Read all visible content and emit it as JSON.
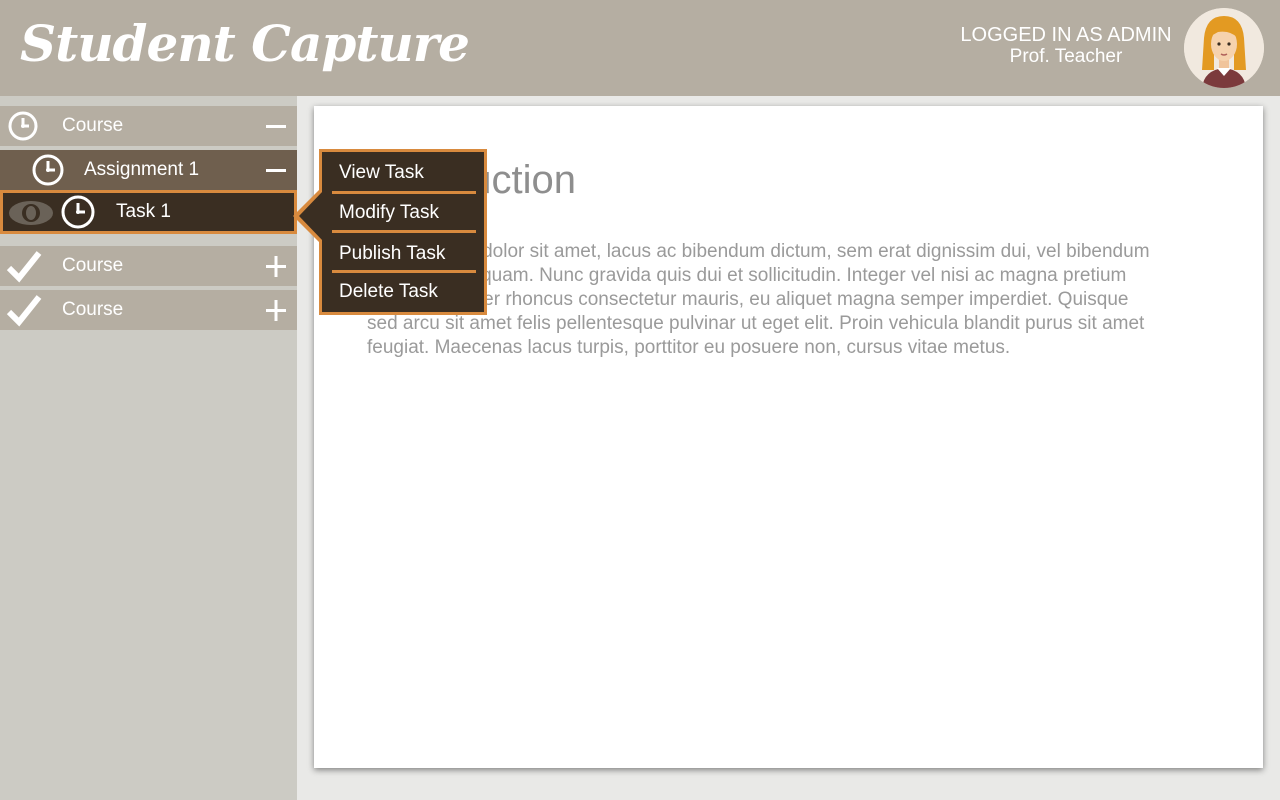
{
  "header": {
    "logo_text": "Student Capture",
    "user_role": "LOGGED IN AS ADMIN",
    "user_name": "Prof. Teacher"
  },
  "sidebar": {
    "course1": {
      "label": "Course",
      "toggle": "collapse",
      "icon": "clock-icon"
    },
    "assignment": {
      "label": "Assignment 1",
      "toggle": "collapse",
      "icon": "clock-icon"
    },
    "task": {
      "label": "Task 1",
      "icons": [
        "eye-icon",
        "clock-icon"
      ]
    },
    "course2": {
      "label": "Course",
      "toggle": "expand",
      "icon": "check-icon"
    },
    "course3": {
      "label": "Course",
      "toggle": "expand",
      "icon": "check-icon"
    }
  },
  "context_menu": {
    "items": [
      {
        "label": "View Task"
      },
      {
        "label": "Modify Task"
      },
      {
        "label": "Publish Task"
      },
      {
        "label": "Delete Task"
      }
    ]
  },
  "content": {
    "title": "Introduction",
    "body": "Lorem ipsum dolor sit amet, lacus ac bibendum dictum, sem erat dignissim dui, vel bibendum ante nulla eu quam. Nunc gravida quis dui et sollicitudin. Integer vel nisi ac magna pretium porttitor. Integer rhoncus consectetur mauris, eu aliquet magna semper imperdiet. Quisque sed arcu sit amet felis pellentesque pulvinar ut eget elit. Proin vehicula blandit purus sit amet feugiat. Maecenas lacus turpis, porttitor eu posuere non, cursus vitae metus."
  },
  "colors": {
    "header_bg": "#b5aea2",
    "sidebar_bg": "#cccbc4",
    "assignment_bg": "#6f5f4e",
    "task_bg": "#3a2e22",
    "accent": "#d88a3e",
    "page_bg": "#e9e9e7"
  }
}
